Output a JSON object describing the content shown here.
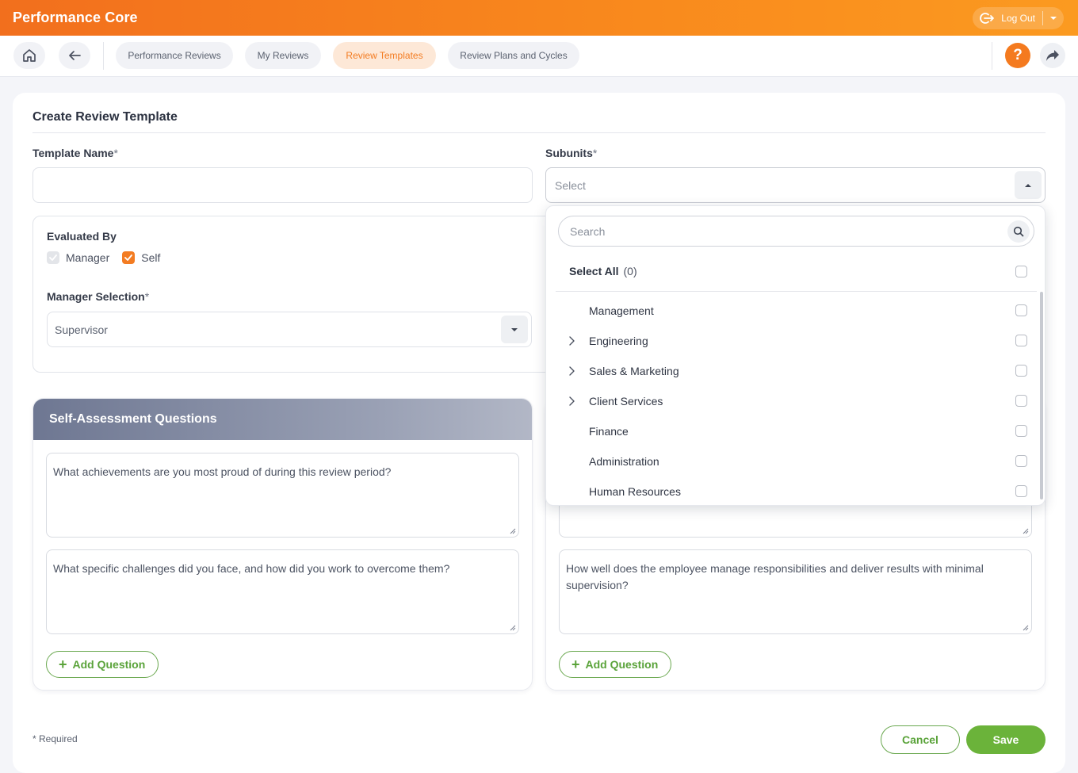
{
  "app": {
    "title": "Performance Core"
  },
  "header": {
    "logout_label": "Log Out"
  },
  "nav": {
    "tabs": [
      {
        "label": "Performance Reviews",
        "active": false
      },
      {
        "label": "My Reviews",
        "active": false
      },
      {
        "label": "Review Templates",
        "active": true
      },
      {
        "label": "Review Plans and Cycles",
        "active": false
      }
    ],
    "help_label": "?"
  },
  "form": {
    "title": "Create Review Template",
    "template_name": {
      "label": "Template Name",
      "required_mark": "*",
      "value": ""
    },
    "subunits": {
      "label": "Subunits",
      "required_mark": "*",
      "placeholder": "Select"
    },
    "evaluated_by": {
      "label": "Evaluated By",
      "options": [
        {
          "label": "Manager",
          "checked": true,
          "disabled": true
        },
        {
          "label": "Self",
          "checked": true,
          "disabled": false
        }
      ]
    },
    "manager_selection": {
      "label": "Manager Selection",
      "required_mark": "*",
      "value": "Supervisor"
    },
    "self_assessment": {
      "title": "Self-Assessment Questions",
      "questions": [
        "What achievements are you most proud of during this review period?",
        "What specific challenges did you face, and how did you work to overcome them?"
      ],
      "add_label": "Add Question"
    },
    "manager_assessment": {
      "questions": [
        "",
        "How well does the employee manage responsibilities and deliver results with minimal supervision?"
      ],
      "add_label": "Add Question"
    },
    "required_note": "* Required",
    "cancel_label": "Cancel",
    "save_label": "Save"
  },
  "dropdown": {
    "search_placeholder": "Search",
    "select_all_label": "Select All",
    "select_all_count": "(0)",
    "items": [
      {
        "label": "Management",
        "expandable": false
      },
      {
        "label": "Engineering",
        "expandable": true
      },
      {
        "label": "Sales & Marketing",
        "expandable": true
      },
      {
        "label": "Client Services",
        "expandable": true
      },
      {
        "label": "Finance",
        "expandable": false
      },
      {
        "label": "Administration",
        "expandable": false
      },
      {
        "label": "Human Resources",
        "expandable": false
      }
    ]
  },
  "colors": {
    "brand_orange": "#f37c22",
    "action_green": "#6bb33a",
    "panel_header": "#7d859e"
  }
}
